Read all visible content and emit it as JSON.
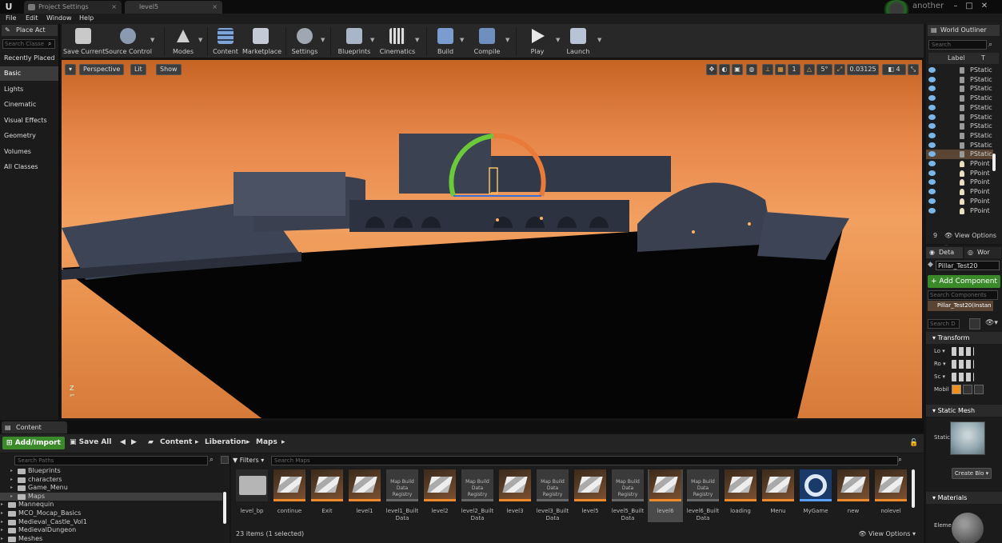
{
  "titlebar": {
    "tabs": [
      {
        "label": "Project Settings"
      },
      {
        "label": "level5"
      }
    ],
    "project_name": "another"
  },
  "menu": {
    "items": [
      "File",
      "Edit",
      "Window",
      "Help"
    ]
  },
  "toolbar": {
    "buttons": [
      {
        "label": "Save Current",
        "icon": "save-icon"
      },
      {
        "label": "Source Control",
        "icon": "source-control-icon"
      },
      {
        "label": "Modes",
        "icon": "modes-icon"
      },
      {
        "label": "Content",
        "icon": "content-icon"
      },
      {
        "label": "Marketplace",
        "icon": "marketplace-icon"
      },
      {
        "label": "Settings",
        "icon": "settings-icon"
      },
      {
        "label": "Blueprints",
        "icon": "blueprints-icon"
      },
      {
        "label": "Cinematics",
        "icon": "cinematics-icon"
      },
      {
        "label": "Build",
        "icon": "build-icon"
      },
      {
        "label": "Compile",
        "icon": "compile-icon"
      },
      {
        "label": "Play",
        "icon": "play-icon"
      },
      {
        "label": "Launch",
        "icon": "launch-icon"
      }
    ]
  },
  "place_actors": {
    "tab": "Place Act",
    "search_placeholder": "Search Classe",
    "categories": [
      "Recently Placed",
      "Basic",
      "Lights",
      "Cinematic",
      "Visual Effects",
      "Geometry",
      "Volumes",
      "All Classes"
    ],
    "selected": "Basic"
  },
  "viewport": {
    "perspective": "Perspective",
    "lit": "Lit",
    "show": "Show",
    "grid_snap": "1",
    "rotation_snap": "5°",
    "scale_snap": "0.03125",
    "camera_speed": "4"
  },
  "outliner": {
    "tab": "World Outliner",
    "search_placeholder": "Search",
    "col_label": "Label",
    "col_type": "T",
    "rows": [
      "PStatic",
      "PStatic",
      "PStatic",
      "PStatic",
      "PStatic",
      "PStatic",
      "PStatic",
      "PStatic",
      "PStatic",
      "PStatic",
      "PPoint",
      "PPoint",
      "PPoint",
      "PPoint",
      "PPoint",
      "PPoint"
    ],
    "selected_row": "PStatic",
    "count": "9",
    "view_options": "View Options"
  },
  "details": {
    "tab_details": "Deta",
    "tab_world": "Wor",
    "object_name": "Pillar_Test20",
    "add_component": "+ Add Component",
    "search_placeholder": "Search Components",
    "component": "Pillar_Test20(Instan",
    "details_search": "Search D",
    "transform": "Transform",
    "location": "Lo",
    "rotation": "Ro",
    "scale": "Sc",
    "mobility": "Mobil",
    "static_mesh_section": "Static Mesh",
    "static_mesh_label": "Static",
    "create_blueprint": "Create Blo",
    "materials_section": "Materials",
    "element_label": "Eleme"
  },
  "content_browser": {
    "tab": "Content Browser",
    "add_import": "Add/Import",
    "save_all": "Save All",
    "breadcrumb": [
      "Content",
      "Liberation",
      "Maps"
    ],
    "search_paths_placeholder": "Search Paths",
    "tree": [
      {
        "label": "Blueprints",
        "indent": 2
      },
      {
        "label": "characters",
        "indent": 2
      },
      {
        "label": "Game_Menu",
        "indent": 2
      },
      {
        "label": "Maps",
        "indent": 2,
        "selected": true
      },
      {
        "label": "Mannequin",
        "indent": 1
      },
      {
        "label": "MCO_Mocap_Basics",
        "indent": 1
      },
      {
        "label": "Medieval_Castle_Vol1",
        "indent": 1
      },
      {
        "label": "MedievalDungeon",
        "indent": 1
      },
      {
        "label": "Meshes",
        "indent": 1
      }
    ],
    "filters": "Filters",
    "search_maps_placeholder": "Search Maps",
    "assets": [
      {
        "name": "level_bp",
        "kind": "folder"
      },
      {
        "name": "continue",
        "kind": "map"
      },
      {
        "name": "Exit",
        "kind": "map"
      },
      {
        "name": "level1",
        "kind": "map"
      },
      {
        "name": "level1_Built Data",
        "kind": "registry"
      },
      {
        "name": "level2",
        "kind": "map"
      },
      {
        "name": "level2_Built Data",
        "kind": "registry"
      },
      {
        "name": "level3",
        "kind": "map"
      },
      {
        "name": "level3_Built Data",
        "kind": "registry"
      },
      {
        "name": "level5",
        "kind": "map"
      },
      {
        "name": "level5_Built Data",
        "kind": "registry"
      },
      {
        "name": "level6",
        "kind": "map",
        "selected": true
      },
      {
        "name": "level6_Built Data",
        "kind": "registry"
      },
      {
        "name": "loading",
        "kind": "map"
      },
      {
        "name": "Menu",
        "kind": "map"
      },
      {
        "name": "MyGame",
        "kind": "game"
      },
      {
        "name": "new",
        "kind": "map"
      },
      {
        "name": "nolevel",
        "kind": "map"
      }
    ],
    "registry_label": "Map Build Data Registry",
    "items_count": "23 items (1 selected)",
    "view_options": "View Options"
  }
}
